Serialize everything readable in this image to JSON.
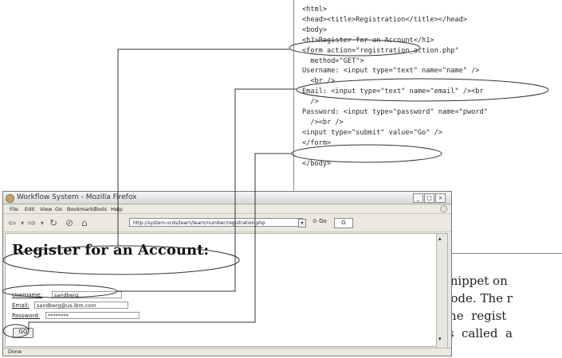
{
  "code_panel": {
    "lines": [
      "<html>",
      "<head><title>Registration</title></head>",
      "<body>",
      "<h1>Register for an Account</h1>",
      "<form action=\"registration_action.php\"",
      "  method=\"GET\">",
      "Username: <input type=\"text\" name=\"name\" />",
      "  <br />",
      "Email: <input type=\"text\" name=\"email\" /><br",
      "  />",
      "Password: <input type=\"password\" name=\"pword\"",
      "  /><br />",
      "<input type=\"submit\" value=\"Go\" />",
      "</form>",
      "",
      "</body>"
    ]
  },
  "prose": {
    "lines": [
      "snippet on",
      "code. The r",
      "the  regist",
      "is  called  a"
    ]
  },
  "browser": {
    "window_title": "Workflow System - Mozilla Firefox",
    "menu": [
      "File",
      "Edit",
      "View",
      "Go",
      "Bookmarks",
      "Tools",
      "Help"
    ],
    "url": "http://system-vcds/learn/learn/number/registration.php",
    "go_label": "Go",
    "search_label": "G",
    "page": {
      "heading": "Register for an Account:",
      "username_label": "Username:",
      "username_value": "sandberg",
      "email_label": "Email:",
      "email_value": "sandberg@us.ibm.com",
      "password_label": "Password:",
      "password_value": "********",
      "submit_label": "GO"
    },
    "status": "Done"
  }
}
